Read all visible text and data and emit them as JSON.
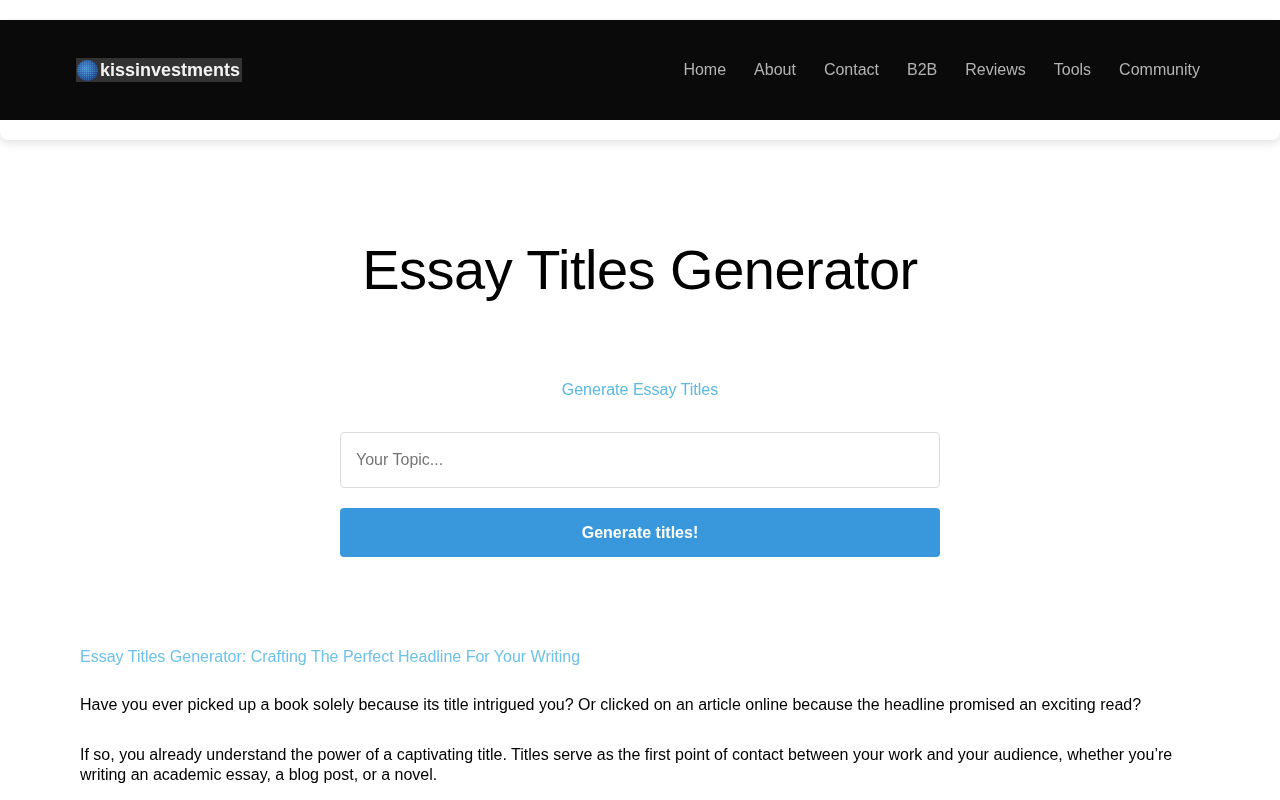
{
  "header": {
    "logo": {
      "text": "kissinvestments"
    },
    "nav": [
      "Home",
      "About",
      "Contact",
      "B2B",
      "Reviews",
      "Tools",
      "Community"
    ]
  },
  "hero": {
    "title": "Essay Titles Generator"
  },
  "generator": {
    "heading": "Generate Essay Titles",
    "topic_field": {
      "placeholder": "Your Topic..."
    },
    "button": "Generate titles!"
  },
  "article": {
    "heading": "Essay Titles Generator: Crafting The Perfect Headline For Your Writing",
    "paragraphs": [
      "Have you ever picked up a book solely because its title intrigued you? Or clicked on an article online because the headline promised an exciting read?",
      "If so, you already understand the power of a captivating title. Titles serve as the first point of contact between your work and your audience, whether you’re writing an academic essay, a blog post, or a novel."
    ]
  }
}
